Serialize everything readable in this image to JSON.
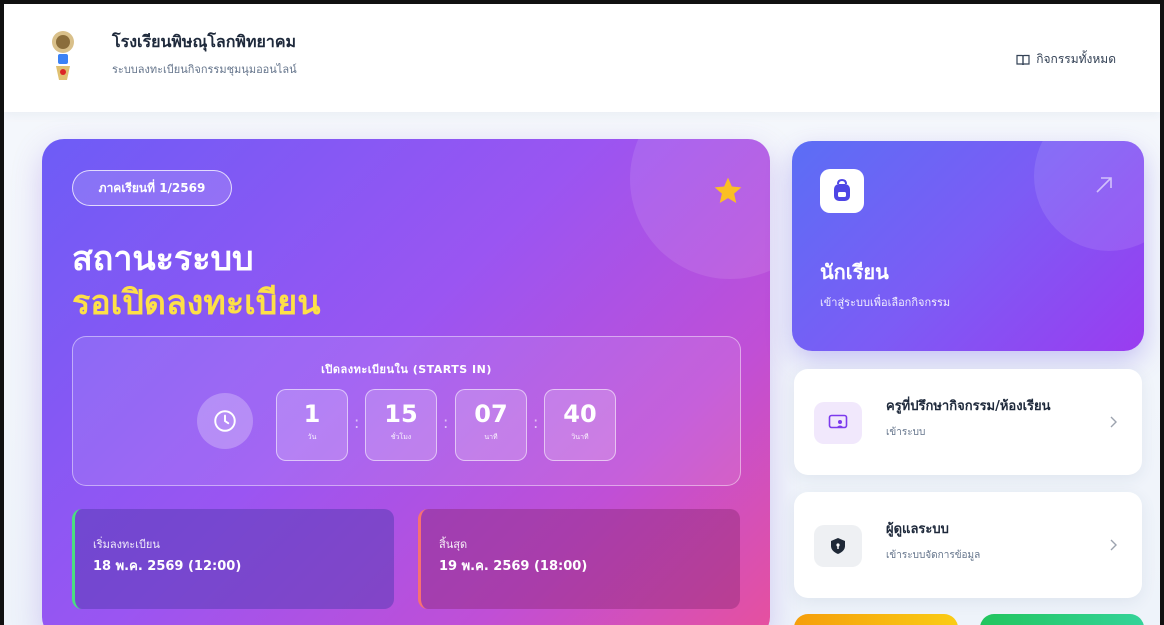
{
  "header": {
    "school_name": "โรงเรียนพิษณุโลกพิทยาคม",
    "subtitle": "ระบบลงทะเบียนกิจกรรมชุมนุมออนไลน์",
    "all_activities": "กิจกรรมทั้งหมด"
  },
  "hero": {
    "semester": "ภาคเรียนที่ 1/2569",
    "status_title": "สถานะระบบ",
    "status_value": "รอเปิดลงทะเบียน",
    "countdown_label": "เปิดลงทะเบียนใน (STARTS IN)",
    "countdown": [
      {
        "value": "1",
        "unit": "วัน"
      },
      {
        "value": "15",
        "unit": "ชั่วโมง"
      },
      {
        "value": "07",
        "unit": "นาที"
      },
      {
        "value": "40",
        "unit": "วินาที"
      }
    ],
    "start_label": "เริ่มลงทะเบียน",
    "start_value": "18 พ.ค. 2569 (12:00)",
    "end_label": "สิ้นสุด",
    "end_value": "19 พ.ค. 2569 (18:00)"
  },
  "student": {
    "title": "นักเรียน",
    "subtitle": "เข้าสู่ระบบเพื่อเลือกกิจกรรม"
  },
  "teacher": {
    "title": "ครูที่ปรึกษากิจกรรม/ห้องเรียน",
    "subtitle": "เข้าระบบ"
  },
  "admin": {
    "title": "ผู้ดูแลระบบ",
    "subtitle": "เข้าระบบจัดการข้อมูล"
  },
  "colors": {
    "accent_yellow": "#fde047",
    "start_border": "#4ade80",
    "end_border": "#f87171"
  },
  "icons": {
    "logo": "school-emblem",
    "book": "book-icon",
    "star": "star-icon",
    "clock": "clock-icon",
    "student": "backpack-icon",
    "teacher": "presentation-icon",
    "admin": "shield-icon",
    "arrow": "arrow-up-right-icon",
    "chevron": "chevron-right-icon"
  }
}
